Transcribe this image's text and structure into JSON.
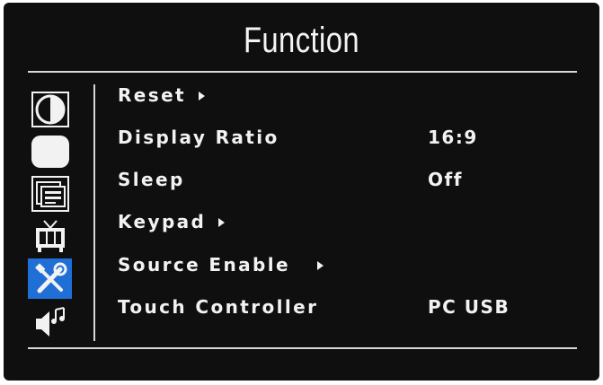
{
  "osd": {
    "title": "Function",
    "sidebar": {
      "selected_index": 4,
      "icons": [
        {
          "name": "brightness-contrast-icon"
        },
        {
          "name": "image-shape-icon"
        },
        {
          "name": "osd-settings-icon"
        },
        {
          "name": "tv-icon"
        },
        {
          "name": "tools-icon"
        },
        {
          "name": "audio-icon"
        }
      ]
    },
    "menu": [
      {
        "label": "Reset",
        "has_submenu": true,
        "value": ""
      },
      {
        "label": "Display Ratio",
        "has_submenu": false,
        "value": "16:9"
      },
      {
        "label": "Sleep",
        "has_submenu": false,
        "value": "Off"
      },
      {
        "label": "Keypad",
        "has_submenu": true,
        "value": ""
      },
      {
        "label": "Source Enable",
        "has_submenu": true,
        "value": ""
      },
      {
        "label": "Touch Controller",
        "has_submenu": false,
        "value": "PC USB"
      }
    ],
    "colors": {
      "background": "#0f0f0f",
      "text": "#f2f2f2",
      "selected_icon_bg": "#1f6fd6",
      "divider": "#d8d8d8"
    }
  }
}
